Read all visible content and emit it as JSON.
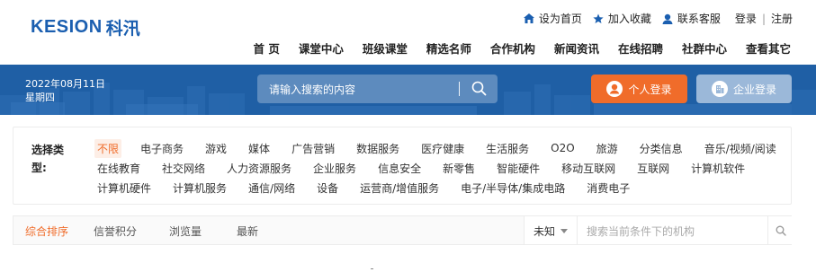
{
  "brand": {
    "logo_en": "KESION",
    "logo_cn": "科汛"
  },
  "top_links": {
    "homepage": "设为首页",
    "favorite": "加入收藏",
    "service": "联系客服",
    "login": "登录",
    "separator": "|",
    "register": "注册"
  },
  "nav": {
    "items": [
      "首 页",
      "课堂中心",
      "班级课堂",
      "精选名师",
      "合作机构",
      "新闻资讯",
      "在线招聘",
      "社群中心",
      "查看其它"
    ]
  },
  "banner": {
    "date": "2022年08月11日",
    "weekday": "星期四",
    "search_placeholder": "请输入搜索的内容",
    "personal_login": "个人登录",
    "company_login": "企业登录"
  },
  "filter": {
    "label": "选择类型:",
    "rows": [
      [
        "不限",
        "电子商务",
        "游戏",
        "媒体",
        "广告营销",
        "数据服务",
        "医疗健康",
        "生活服务",
        "O2O",
        "旅游",
        "分类信息",
        "音乐/视频/阅读"
      ],
      [
        "在线教育",
        "社交网络",
        "人力资源服务",
        "企业服务",
        "信息安全",
        "新零售",
        "智能硬件",
        "移动互联网",
        "互联网",
        "计算机软件"
      ],
      [
        "计算机硬件",
        "计算机服务",
        "通信/网络",
        "设备",
        "运营商/增值服务",
        "电子/半导体/集成电路",
        "消费电子"
      ]
    ],
    "active": "不限"
  },
  "sortbar": {
    "items": [
      "综合排序",
      "信誉积分",
      "浏览量",
      "最新"
    ],
    "active": "综合排序",
    "select_value": "未知",
    "search_placeholder": "搜索当前条件下的机构"
  },
  "colors": {
    "brand_blue": "#1b5fb0",
    "banner_blue": "#1f5fa5",
    "accent_orange": "#f06c2a"
  }
}
